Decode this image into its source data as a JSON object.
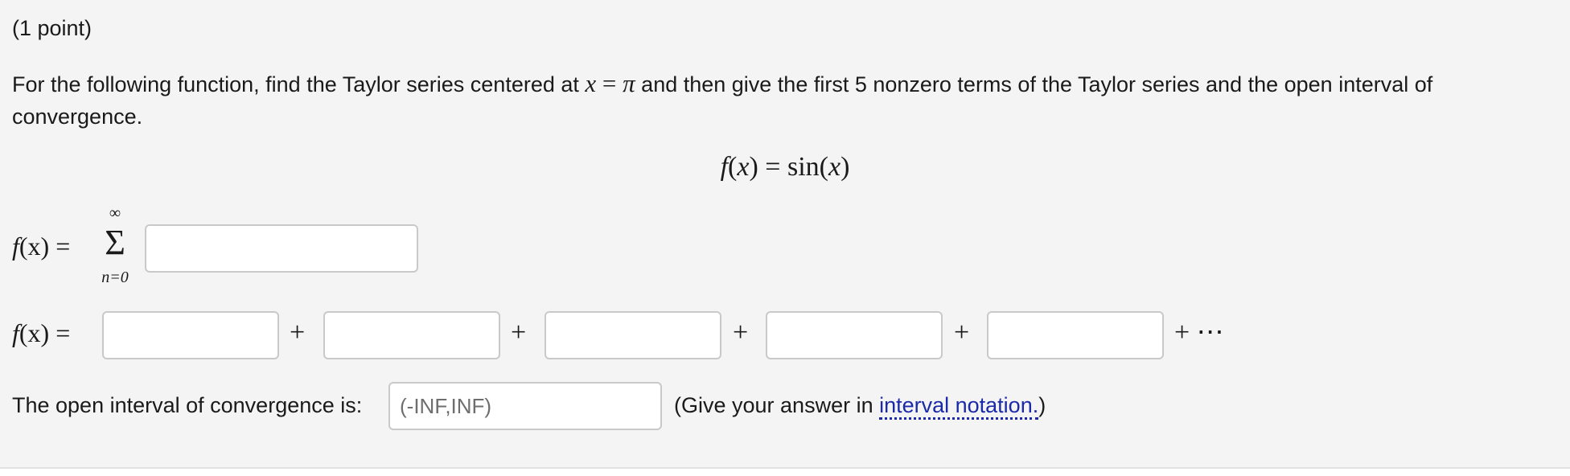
{
  "problem": {
    "points": "(1 point)",
    "prompt_before": "For the following function, find the Taylor series centered at ",
    "prompt_math_var": "x",
    "prompt_math_eq": " = ",
    "prompt_math_pi": "π",
    "prompt_after": " and then give the first 5 nonzero terms of the Taylor series and the open interval of convergence.",
    "function": {
      "lhs_f": "f",
      "lhs_open": "(",
      "lhs_var": "x",
      "lhs_close": ") = ",
      "rhs_func": "sin(",
      "rhs_var": "x",
      "rhs_close": ")"
    }
  },
  "series_row": {
    "label_f": "f",
    "label_rest": "(x) = ",
    "sum_upper": "∞",
    "sum_symbol": "Σ",
    "sum_lower": "n=0",
    "answer_value": ""
  },
  "terms_row": {
    "label_f": "f",
    "label_rest": "(x) = ",
    "terms": [
      "",
      "",
      "",
      "",
      ""
    ],
    "plus": "+",
    "trailing": "+ ⋯"
  },
  "interval_row": {
    "label": "The open interval of convergence is:",
    "placeholder": "(-INF,INF)",
    "note_before": "(Give your answer in ",
    "note_link": "interval notation.",
    "note_after": ")"
  }
}
